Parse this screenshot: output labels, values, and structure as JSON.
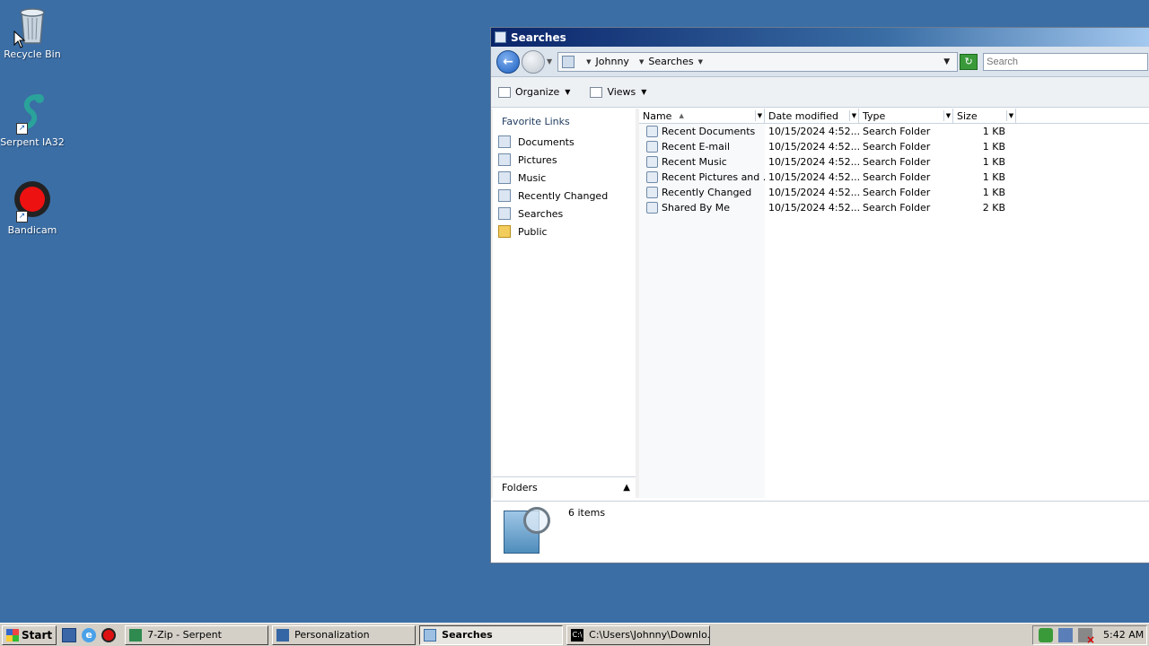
{
  "desktop": {
    "icons": [
      {
        "label": "Recycle Bin"
      },
      {
        "label": "Serpent IA32"
      },
      {
        "label": "Bandicam"
      }
    ]
  },
  "window": {
    "title": "Searches",
    "address": {
      "breadcrumbs": [
        "Johnny",
        "Searches"
      ],
      "search_placeholder": "Search"
    },
    "toolbar": {
      "organize_label": "Organize",
      "views_label": "Views"
    },
    "nav": {
      "section_title": "Favorite Links",
      "items": [
        {
          "label": "Documents",
          "icon": "documents-icon"
        },
        {
          "label": "Pictures",
          "icon": "pictures-icon"
        },
        {
          "label": "Music",
          "icon": "music-icon"
        },
        {
          "label": "Recently Changed",
          "icon": "recently-changed-icon"
        },
        {
          "label": "Searches",
          "icon": "searches-icon"
        },
        {
          "label": "Public",
          "icon": "folder-icon"
        }
      ],
      "folders_label": "Folders"
    },
    "columns": [
      "Name",
      "Date modified",
      "Type",
      "Size"
    ],
    "rows": [
      {
        "name": "Recent Documents",
        "date": "10/15/2024 4:52...",
        "type": "Search Folder",
        "size": "1 KB"
      },
      {
        "name": "Recent E-mail",
        "date": "10/15/2024 4:52...",
        "type": "Search Folder",
        "size": "1 KB"
      },
      {
        "name": "Recent Music",
        "date": "10/15/2024 4:52...",
        "type": "Search Folder",
        "size": "1 KB"
      },
      {
        "name": "Recent Pictures and ...",
        "date": "10/15/2024 4:52...",
        "type": "Search Folder",
        "size": "1 KB"
      },
      {
        "name": "Recently Changed",
        "date": "10/15/2024 4:52...",
        "type": "Search Folder",
        "size": "1 KB"
      },
      {
        "name": "Shared By Me",
        "date": "10/15/2024 4:52...",
        "type": "Search Folder",
        "size": "2 KB"
      }
    ],
    "details": {
      "item_count": "6 items"
    }
  },
  "taskbar": {
    "start_label": "Start",
    "buttons": [
      {
        "label": "7-Zip - Serpent"
      },
      {
        "label": "Personalization"
      },
      {
        "label": "Searches"
      },
      {
        "label": "C:\\Users\\Johnny\\Downlo..."
      }
    ],
    "clock": "5:42 AM"
  },
  "colors": {
    "desktop": "#3b6ea5",
    "title_gradient_start": "#0a246a",
    "taskbar": "#d4d0c8"
  }
}
